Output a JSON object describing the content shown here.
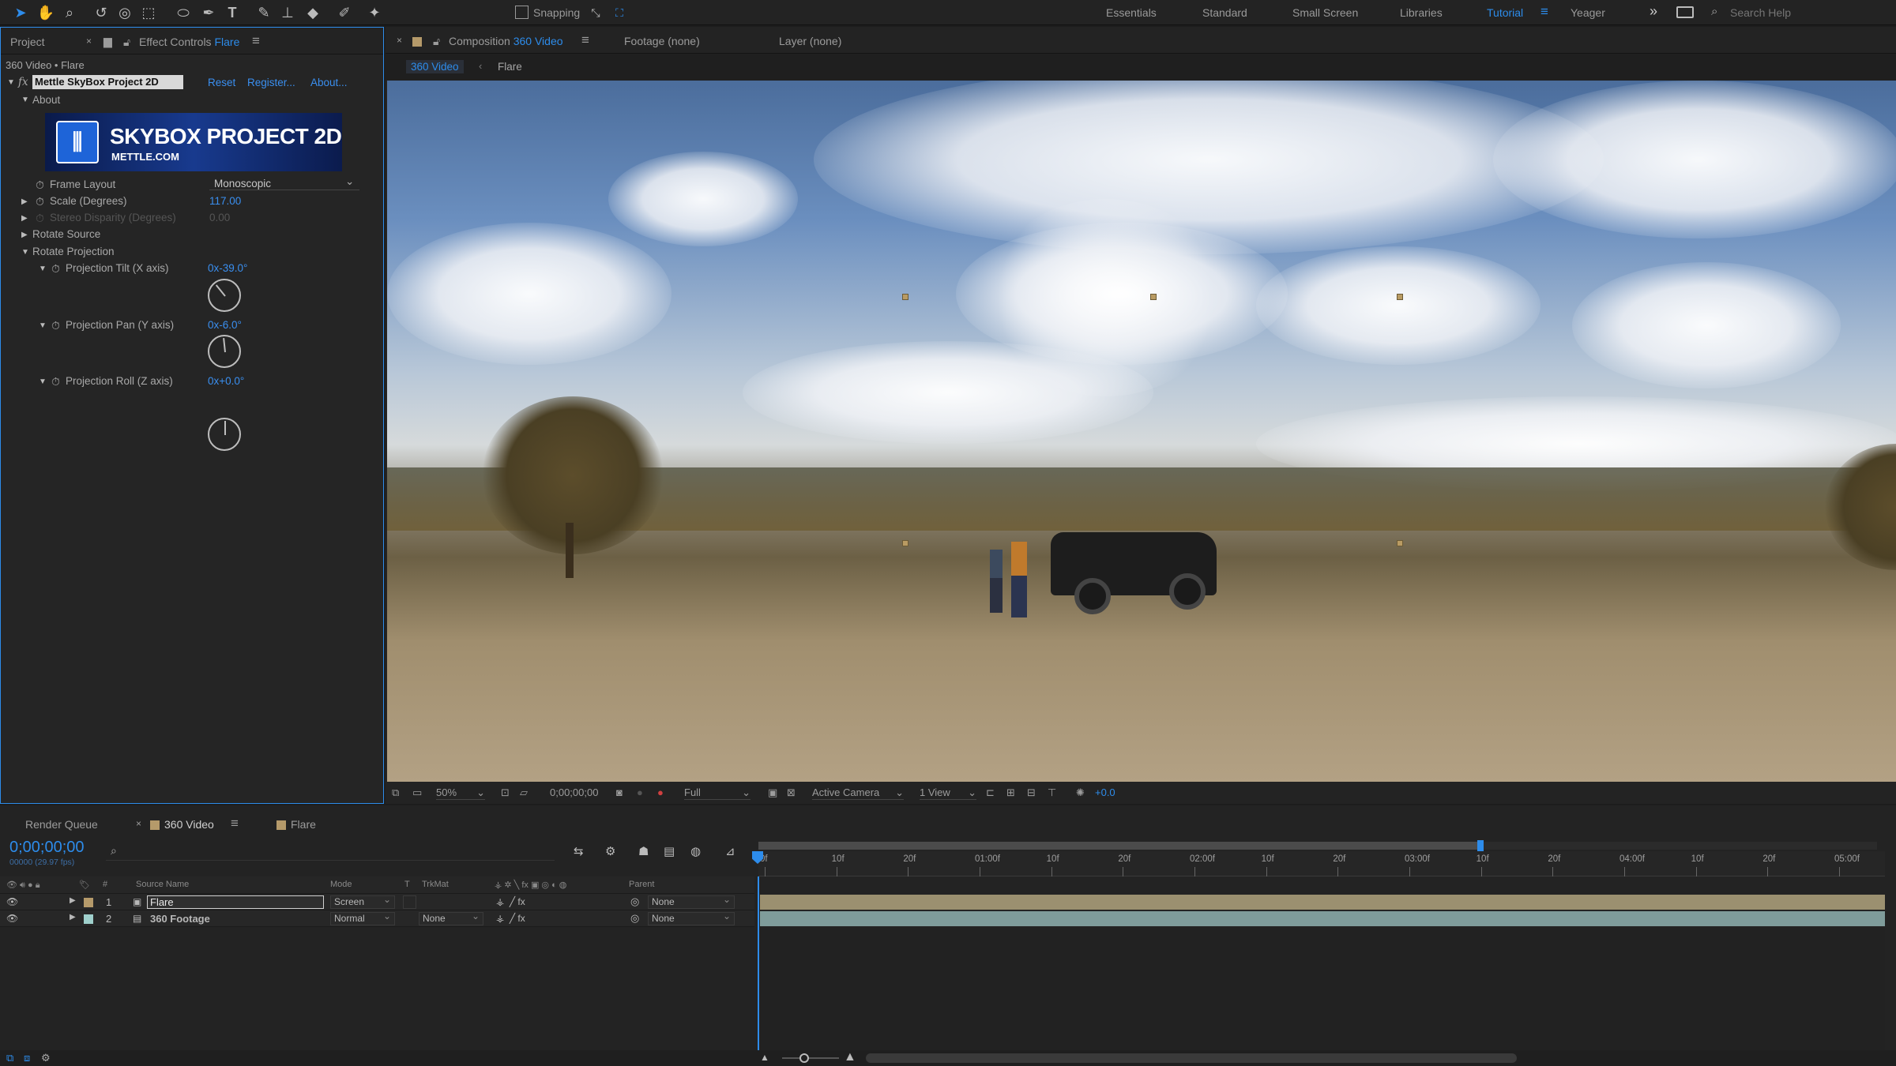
{
  "toolbar": {
    "snapping_label": "Snapping",
    "workspaces": [
      "Essentials",
      "Standard",
      "Small Screen",
      "Libraries",
      "Tutorial",
      "Yeager"
    ],
    "active_workspace": "Tutorial",
    "search_placeholder": "Search Help"
  },
  "left_panel": {
    "tab_project": "Project",
    "tab_effect_prefix": "Effect Controls",
    "tab_effect_layer": "Flare",
    "breadcrumb": "360 Video • Flare",
    "effect_name": "Mettle SkyBox Project 2D",
    "reset": "Reset",
    "register": "Register...",
    "about": "About...",
    "about_group": "About",
    "banner_title": "SKYBOX PROJECT 2D",
    "banner_sub": "METTLE.COM",
    "frame_layout_label": "Frame Layout",
    "frame_layout_value": "Monoscopic",
    "scale_label": "Scale (Degrees)",
    "scale_value": "117.00",
    "stereo_label": "Stereo Disparity (Degrees)",
    "stereo_value": "0.00",
    "rotate_source": "Rotate Source",
    "rotate_projection": "Rotate Projection",
    "tilt_label": "Projection Tilt (X axis)",
    "tilt_value": "0x-39.0°",
    "pan_label": "Projection Pan (Y axis)",
    "pan_value": "0x-6.0°",
    "roll_label": "Projection Roll (Z axis)",
    "roll_value": "0x+0.0°",
    "tilt_angle": -39,
    "pan_angle": -6,
    "roll_angle": 0
  },
  "viewer": {
    "tab_comp_prefix": "Composition",
    "tab_comp_name": "360 Video",
    "tab_footage": "Footage (none)",
    "tab_layer": "Layer (none)",
    "crumb_1": "360 Video",
    "crumb_2": "Flare",
    "zoom": "50%",
    "timecode": "0;00;00;00",
    "resolution": "Full",
    "camera": "Active Camera",
    "views": "1 View",
    "exposure": "+0.0"
  },
  "timeline": {
    "tab_render": "Render Queue",
    "tab_comp": "360 Video",
    "tab_flare": "Flare",
    "timecode": "0;00;00;00",
    "fps": "00000 (29.97 fps)",
    "col_num": "#",
    "col_source": "Source Name",
    "col_mode": "Mode",
    "col_t": "T",
    "col_trkmat": "TrkMat",
    "col_parent": "Parent",
    "ruler": [
      "0f",
      "10f",
      "20f",
      "01:00f",
      "10f",
      "20f",
      "02:00f",
      "10f",
      "20f",
      "03:00f",
      "10f",
      "20f",
      "04:00f",
      "10f",
      "20f",
      "05:00f"
    ],
    "layers": [
      {
        "num": "1",
        "name": "Flare",
        "mode": "Screen",
        "trkmat": "",
        "parent": "None",
        "color": "#b59a6a",
        "bar": "#9b9070"
      },
      {
        "num": "2",
        "name": "360 Footage",
        "mode": "Normal",
        "trkmat": "None",
        "parent": "None",
        "color": "#9fd0cc",
        "bar": "#7f9c9b"
      }
    ]
  }
}
